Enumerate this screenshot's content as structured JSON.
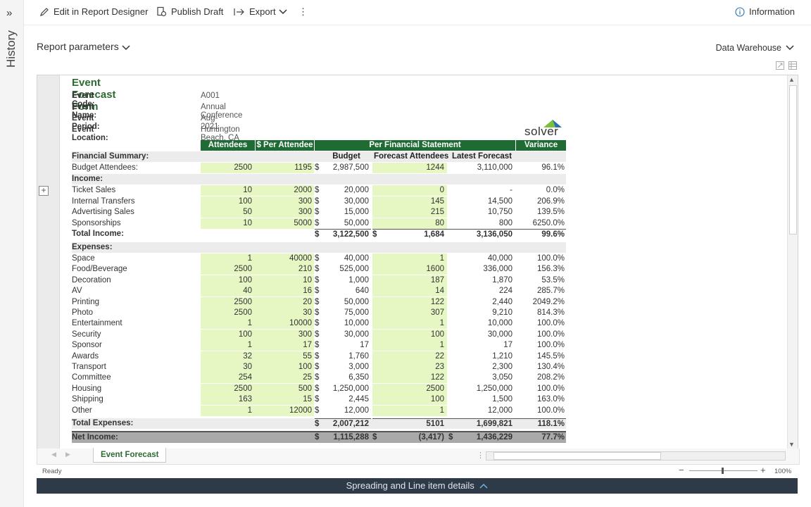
{
  "sidebar": {
    "expand_glyph": "»",
    "label": "History"
  },
  "toolbar": {
    "edit_label": "Edit in Report Designer",
    "publish_label": "Publish Draft",
    "export_label": "Export",
    "more_glyph": "⋮",
    "info_label": "Information"
  },
  "params": {
    "label": "Report parameters",
    "datasource": "Data Warehouse"
  },
  "report": {
    "title": "Event Forecast Form",
    "info": [
      {
        "label": "Event Code:",
        "value": "A001"
      },
      {
        "label": "Event Name:",
        "value": "Annual Conference"
      },
      {
        "label": "Event Period:",
        "value": "Aug-2021"
      },
      {
        "label": "Event Location:",
        "value": "Huntington Beach, CA"
      }
    ],
    "logo": "solver",
    "headers": {
      "attendees": "Attendees",
      "per_attendee": "$ Per Attendee",
      "per_fs": "Per Financial Statement",
      "variance": "Variance",
      "budget": "Budget",
      "forecast_att": "Forecast Attendees",
      "latest_forecast": "Latest Forecast"
    },
    "financial_summary": "Financial Summary:",
    "budget_attendees": {
      "label": "Budget Attendees:",
      "att": "2500",
      "spa": "1195",
      "cur": "$",
      "budget": "2,987,500",
      "fa": "1244",
      "lf": "3,110,000",
      "var": "96.1%"
    },
    "income_label": "Income:",
    "income": [
      {
        "label": "Ticket Sales",
        "att": "10",
        "spa": "2000",
        "cur": "$",
        "budget": "20,000",
        "fa": "0",
        "lf": "-",
        "var": "0.0%"
      },
      {
        "label": "Internal Transfers",
        "att": "100",
        "spa": "300",
        "cur": "$",
        "budget": "30,000",
        "fa": "145",
        "lf": "14,500",
        "var": "206.9%"
      },
      {
        "label": "Advertising Sales",
        "att": "50",
        "spa": "300",
        "cur": "$",
        "budget": "15,000",
        "fa": "215",
        "lf": "10,750",
        "var": "139.5%"
      },
      {
        "label": "Sponsorships",
        "att": "10",
        "spa": "5000",
        "cur": "$",
        "budget": "50,000",
        "fa": "80",
        "lf": "800",
        "var": "6250.0%"
      }
    ],
    "total_income": {
      "label": "Total Income:",
      "cur": "$",
      "budget": "3,122,500",
      "cur2": "$",
      "fa": "1,684",
      "lf": "3,136,050",
      "var": "99.6%"
    },
    "expenses_label": "Expenses:",
    "expenses": [
      {
        "label": "Space",
        "att": "1",
        "spa": "40000",
        "cur": "$",
        "budget": "40,000",
        "fa": "1",
        "lf": "40,000",
        "var": "100.0%"
      },
      {
        "label": "Food/Beverage",
        "att": "2500",
        "spa": "210",
        "cur": "$",
        "budget": "525,000",
        "fa": "1600",
        "lf": "336,000",
        "var": "156.3%"
      },
      {
        "label": "Decoration",
        "att": "100",
        "spa": "10",
        "cur": "$",
        "budget": "1,000",
        "fa": "187",
        "lf": "1,870",
        "var": "53.5%"
      },
      {
        "label": "AV",
        "att": "40",
        "spa": "16",
        "cur": "$",
        "budget": "640",
        "fa": "14",
        "lf": "224",
        "var": "285.7%"
      },
      {
        "label": "Printing",
        "att": "2500",
        "spa": "20",
        "cur": "$",
        "budget": "50,000",
        "fa": "122",
        "lf": "2,440",
        "var": "2049.2%"
      },
      {
        "label": "Photo",
        "att": "2500",
        "spa": "30",
        "cur": "$",
        "budget": "75,000",
        "fa": "307",
        "lf": "9,210",
        "var": "814.3%"
      },
      {
        "label": "Entertainment",
        "att": "1",
        "spa": "10000",
        "cur": "$",
        "budget": "10,000",
        "fa": "1",
        "lf": "10,000",
        "var": "100.0%"
      },
      {
        "label": "Security",
        "att": "100",
        "spa": "300",
        "cur": "$",
        "budget": "30,000",
        "fa": "100",
        "lf": "30,000",
        "var": "100.0%"
      },
      {
        "label": "Sponsor",
        "att": "1",
        "spa": "17",
        "cur": "$",
        "budget": "17",
        "fa": "1",
        "lf": "17",
        "var": "100.0%"
      },
      {
        "label": "Awards",
        "att": "32",
        "spa": "55",
        "cur": "$",
        "budget": "1,760",
        "fa": "22",
        "lf": "1,210",
        "var": "145.5%"
      },
      {
        "label": "Transport",
        "att": "30",
        "spa": "100",
        "cur": "$",
        "budget": "3,000",
        "fa": "23",
        "lf": "2,300",
        "var": "130.4%"
      },
      {
        "label": "Committee",
        "att": "254",
        "spa": "25",
        "cur": "$",
        "budget": "6,350",
        "fa": "122",
        "lf": "3,050",
        "var": "208.2%"
      },
      {
        "label": "Housing",
        "att": "2500",
        "spa": "500",
        "cur": "$",
        "budget": "1,250,000",
        "fa": "2500",
        "lf": "1,250,000",
        "var": "100.0%"
      },
      {
        "label": "Shipping",
        "att": "163",
        "spa": "15",
        "cur": "$",
        "budget": "2,445",
        "fa": "100",
        "lf": "1,500",
        "var": "163.0%"
      },
      {
        "label": "Other",
        "att": "1",
        "spa": "12000",
        "cur": "$",
        "budget": "12,000",
        "fa": "1",
        "lf": "12,000",
        "var": "100.0%"
      }
    ],
    "total_expenses": {
      "label": "Total Expenses:",
      "cur": "$",
      "budget": "2,007,212",
      "fa": "5101",
      "lf": "1,699,821",
      "var": "118.1%"
    },
    "net_income": {
      "label": "Net Income:",
      "cur": "$",
      "budget": "1,115,288",
      "cur2": "$",
      "fa": "(3,417)",
      "cur3": "$",
      "lf": "1,436,229",
      "var": "77.7%"
    }
  },
  "sheet_tab": "Event Forecast",
  "status": {
    "ready": "Ready",
    "zoom": "100%"
  },
  "bottom_bar": {
    "label": "Spreading and Line item details"
  },
  "colors": {
    "header_green": "#1f6b34",
    "input_green": "#e6f7c4",
    "title_green": "#2e6b33",
    "bottom_bar": "#2f3a48"
  }
}
